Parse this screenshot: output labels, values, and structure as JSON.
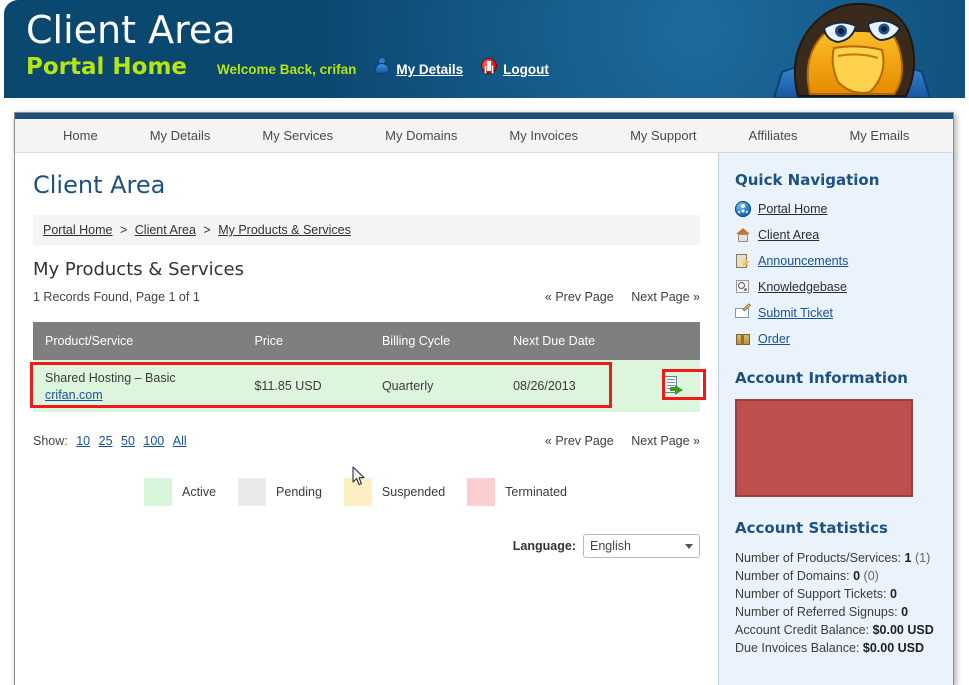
{
  "banner": {
    "title": "Client Area",
    "portal_home": "Portal Home",
    "welcome": "Welcome Back, crifan",
    "my_details": "My Details",
    "logout": "Logout",
    "bg_color": "#0b4870",
    "accent_color": "#b7e512",
    "mascot": "eagle-mascot-icon"
  },
  "nav": {
    "tabs": [
      {
        "label": "Home"
      },
      {
        "label": "My Details"
      },
      {
        "label": "My Services"
      },
      {
        "label": "My Domains"
      },
      {
        "label": "My Invoices"
      },
      {
        "label": "My Support"
      },
      {
        "label": "Affiliates"
      },
      {
        "label": "My Emails"
      }
    ]
  },
  "main": {
    "page_title": "Client Area",
    "breadcrumb": [
      {
        "label": "Portal Home",
        "link": true
      },
      {
        "label": "Client Area",
        "link": true
      },
      {
        "label": "My Products & Services",
        "link": true
      }
    ],
    "breadcrumb_separator": ">",
    "section_title": "My Products & Services",
    "records_found": "1 Records Found, Page 1 of 1",
    "pager": {
      "prev": "« Prev Page",
      "next": "Next Page »"
    },
    "table": {
      "headers": [
        "Product/Service",
        "Price",
        "Billing Cycle",
        "Next Due Date",
        ""
      ],
      "rows": [
        {
          "product": "Shared Hosting – Basic",
          "domain": "crifan.com",
          "price": "$11.85 USD",
          "billing_cycle": "Quarterly",
          "next_due_date": "08/26/2013",
          "action_icon": "view-details-icon",
          "row_status_color": "#ddf5dd"
        }
      ],
      "header_bg": "#807f7f"
    },
    "show": {
      "label": "Show:",
      "options": [
        "10",
        "25",
        "50",
        "100",
        "All"
      ]
    },
    "legend": [
      {
        "label": "Active",
        "color": "#d9f5d9"
      },
      {
        "label": "Pending",
        "color": "#eaeaea"
      },
      {
        "label": "Suspended",
        "color": "#fdeec4"
      },
      {
        "label": "Terminated",
        "color": "#fbcfcf"
      }
    ],
    "language": {
      "label": "Language:",
      "selected": "English",
      "options": [
        "English"
      ]
    },
    "annotation_color": "#ee1c18"
  },
  "sidebar": {
    "quick_nav_title": "Quick Navigation",
    "quick_nav_items": [
      {
        "label": "Portal Home",
        "icon": "globe-icon"
      },
      {
        "label": "Client Area",
        "icon": "house-icon"
      },
      {
        "label": "Announcements",
        "icon": "announcement-icon"
      },
      {
        "label": "Knowledgebase",
        "icon": "magnifier-icon"
      },
      {
        "label": "Submit Ticket",
        "icon": "envelope-pen-icon"
      },
      {
        "label": "Order",
        "icon": "package-icon"
      }
    ],
    "account_info_title": "Account Information",
    "account_info_redacted_color": "#bf4f4f",
    "account_stats_title": "Account Statistics",
    "account_stats": [
      {
        "label": "Number of Products/Services:",
        "value": "1",
        "extra": "(1)"
      },
      {
        "label": "Number of Domains:",
        "value": "0",
        "extra": "(0)"
      },
      {
        "label": "Number of Support Tickets:",
        "value": "0",
        "extra": ""
      },
      {
        "label": "Number of Referred Signups:",
        "value": "0",
        "extra": ""
      },
      {
        "label": "Account Credit Balance:",
        "value": "$0.00 USD",
        "extra": ""
      },
      {
        "label": "Due Invoices Balance:",
        "value": "$0.00 USD",
        "extra": ""
      }
    ]
  }
}
